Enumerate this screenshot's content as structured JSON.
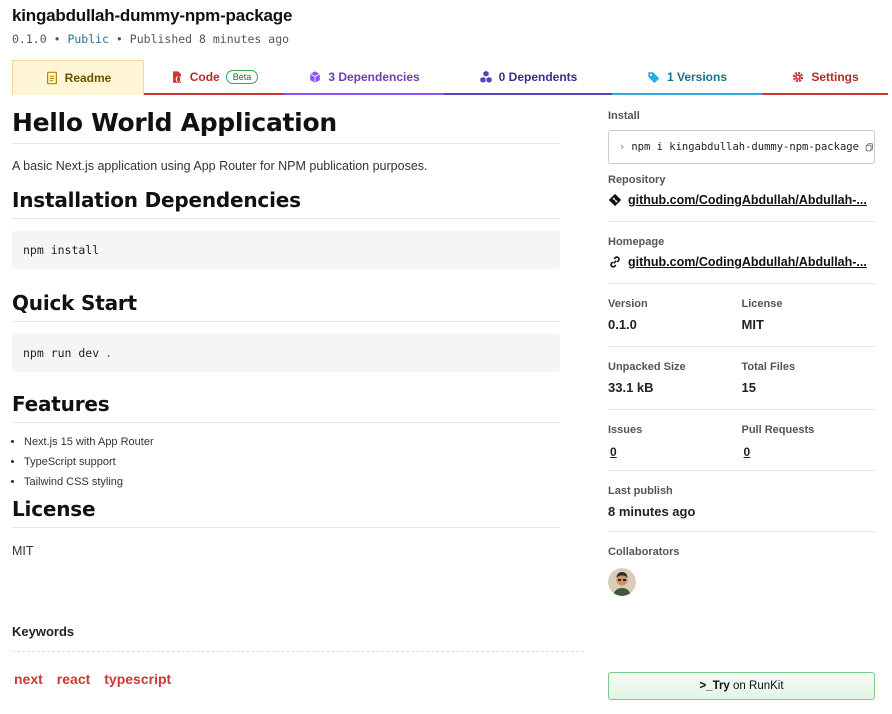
{
  "package": {
    "name": "kingabdullah-dummy-npm-package",
    "version_text": "0.1.0",
    "sep1": "•",
    "visibility": "Public",
    "sep2": "•",
    "published": "Published 8 minutes ago"
  },
  "tabs": [
    {
      "label": "Readme",
      "icon": "readme-icon",
      "color": "#6b5200"
    },
    {
      "label": "Code",
      "badge": "Beta",
      "icon": "code-file-icon",
      "color": "#b32b2b"
    },
    {
      "label": "3 Dependencies",
      "icon": "box-icon",
      "color": "#6b3fb5"
    },
    {
      "label": "0 Dependents",
      "icon": "boxes-icon",
      "color": "#3d2a8a"
    },
    {
      "label": "1 Versions",
      "icon": "tag-icon",
      "color": "#1e6f8f"
    },
    {
      "label": "Settings",
      "icon": "gear-icon",
      "color": "#b32b2b"
    }
  ],
  "readme": {
    "title": "Hello World Application",
    "description": "A basic Next.js application using App Router for NPM publication purposes.",
    "install_heading": "Installation Dependencies",
    "install_cmd": "npm install",
    "quickstart_heading": "Quick Start",
    "quickstart_cmd": "npm run dev",
    "quickstart_suffix": ".",
    "features_heading": "Features",
    "features": [
      "Next.js 15 with App Router",
      "TypeScript support",
      "Tailwind CSS styling"
    ],
    "license_heading": "License",
    "license_text": "MIT"
  },
  "keywords": {
    "title": "Keywords",
    "items": [
      "next",
      "react",
      "typescript"
    ]
  },
  "sidebar": {
    "install_label": "Install",
    "install_chevron": "›",
    "install_cmd": "npm i kingabdullah-dummy-npm-package",
    "repository_label": "Repository",
    "repository_url": "github.com/CodingAbdullah/Abdullah-...",
    "homepage_label": "Homepage",
    "homepage_url": "github.com/CodingAbdullah/Abdullah-...",
    "version_label": "Version",
    "version_value": "0.1.0",
    "license_label": "License",
    "license_value": "MIT",
    "unpacked_label": "Unpacked Size",
    "unpacked_value": "33.1 kB",
    "totalfiles_label": "Total Files",
    "totalfiles_value": "15",
    "issues_label": "Issues",
    "issues_value": "0",
    "pulls_label": "Pull Requests",
    "pulls_value": "0",
    "lastpublish_label": "Last publish",
    "lastpublish_value": "8 minutes ago",
    "collaborators_label": "Collaborators",
    "runkit_prefix": ">_",
    "runkit_bold": "Try",
    "runkit_rest": "on RunKit"
  }
}
